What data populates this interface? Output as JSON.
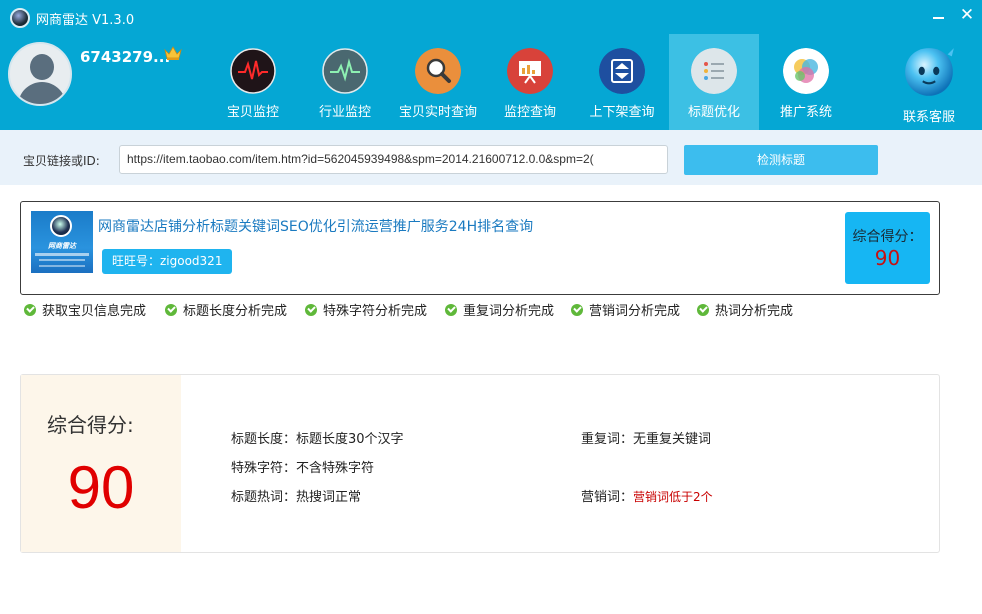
{
  "window": {
    "title": "网商雷达 V1.3.0",
    "minimize_label": "",
    "close_label": "✕"
  },
  "user": {
    "id": "6743279..."
  },
  "nav": {
    "items": [
      {
        "label": "宝贝监控",
        "icon": "heartbeat-icon",
        "color": "#2b1f24"
      },
      {
        "label": "行业监控",
        "icon": "ecg-icon",
        "color": "#4a6870"
      },
      {
        "label": "宝贝实时查询",
        "icon": "search-icon",
        "color": "#ea8f3c"
      },
      {
        "label": "监控查询",
        "icon": "presentation-icon",
        "color": "#d8423a"
      },
      {
        "label": "上下架查询",
        "icon": "updown-icon",
        "color": "#1e4fa0"
      },
      {
        "label": "标题优化",
        "icon": "notes-icon",
        "color": "#dde6ea"
      },
      {
        "label": "推广系统",
        "icon": "color-circles-icon",
        "color": "#ffffff"
      }
    ],
    "support_label": "联系客服",
    "active_index": 5
  },
  "urlbar": {
    "label": "宝贝链接或ID:",
    "value": "https://item.taobao.com/item.htm?id=562045939498&spm=2014.21600712.0.0&spm=2(",
    "button_label": "检测标题"
  },
  "product": {
    "title": "网商雷达店铺分析标题关键词SEO优化引流运营推广服务24H排名查询",
    "wangwang": "旺旺号：zigood321",
    "image_text": "网商雷达",
    "score_label": "综合得分：",
    "score": "90"
  },
  "status": [
    "获取宝贝信息完成",
    "标题长度分析完成",
    "特殊字符分析完成",
    "重复词分析完成",
    "营销词分析完成",
    "热词分析完成"
  ],
  "summary": {
    "score_label": "综合得分:",
    "score": "90",
    "details": {
      "title_length": "标题长度：标题长度30个汉字",
      "special_chars": "特殊字符：不含特殊字符",
      "hot_words": "标题热词：热搜词正常",
      "duplicates": "重复词：无重复关键词",
      "marketing_label": "营销词：",
      "marketing_value": "营销词低于2个"
    }
  },
  "colors": {
    "header": "#05a7d4",
    "active_tab": "#3cc0e4",
    "accent_button": "#3cbdee",
    "score_red": "#e00000",
    "check_green": "#5fb83a"
  }
}
